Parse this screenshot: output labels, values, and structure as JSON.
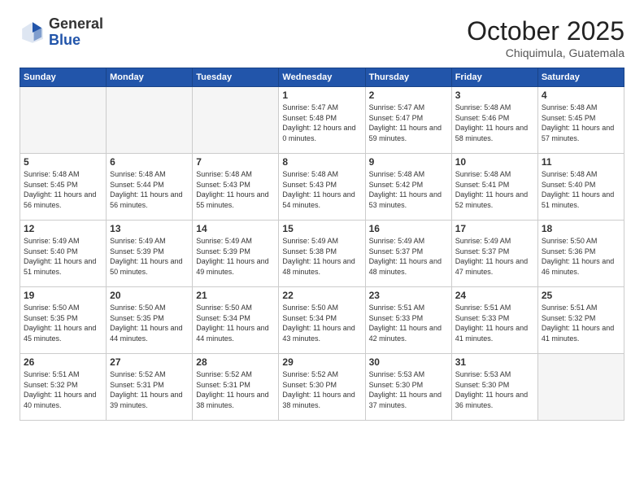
{
  "header": {
    "logo_general": "General",
    "logo_blue": "Blue",
    "month": "October 2025",
    "location": "Chiquimula, Guatemala"
  },
  "days_of_week": [
    "Sunday",
    "Monday",
    "Tuesday",
    "Wednesday",
    "Thursday",
    "Friday",
    "Saturday"
  ],
  "weeks": [
    [
      {
        "num": "",
        "empty": true
      },
      {
        "num": "",
        "empty": true
      },
      {
        "num": "",
        "empty": true
      },
      {
        "num": "1",
        "sunrise": "5:47 AM",
        "sunset": "5:48 PM",
        "daylight": "12 hours and 0 minutes."
      },
      {
        "num": "2",
        "sunrise": "5:47 AM",
        "sunset": "5:47 PM",
        "daylight": "11 hours and 59 minutes."
      },
      {
        "num": "3",
        "sunrise": "5:48 AM",
        "sunset": "5:46 PM",
        "daylight": "11 hours and 58 minutes."
      },
      {
        "num": "4",
        "sunrise": "5:48 AM",
        "sunset": "5:45 PM",
        "daylight": "11 hours and 57 minutes."
      }
    ],
    [
      {
        "num": "5",
        "sunrise": "5:48 AM",
        "sunset": "5:45 PM",
        "daylight": "11 hours and 56 minutes."
      },
      {
        "num": "6",
        "sunrise": "5:48 AM",
        "sunset": "5:44 PM",
        "daylight": "11 hours and 56 minutes."
      },
      {
        "num": "7",
        "sunrise": "5:48 AM",
        "sunset": "5:43 PM",
        "daylight": "11 hours and 55 minutes."
      },
      {
        "num": "8",
        "sunrise": "5:48 AM",
        "sunset": "5:43 PM",
        "daylight": "11 hours and 54 minutes."
      },
      {
        "num": "9",
        "sunrise": "5:48 AM",
        "sunset": "5:42 PM",
        "daylight": "11 hours and 53 minutes."
      },
      {
        "num": "10",
        "sunrise": "5:48 AM",
        "sunset": "5:41 PM",
        "daylight": "11 hours and 52 minutes."
      },
      {
        "num": "11",
        "sunrise": "5:48 AM",
        "sunset": "5:40 PM",
        "daylight": "11 hours and 51 minutes."
      }
    ],
    [
      {
        "num": "12",
        "sunrise": "5:49 AM",
        "sunset": "5:40 PM",
        "daylight": "11 hours and 51 minutes."
      },
      {
        "num": "13",
        "sunrise": "5:49 AM",
        "sunset": "5:39 PM",
        "daylight": "11 hours and 50 minutes."
      },
      {
        "num": "14",
        "sunrise": "5:49 AM",
        "sunset": "5:39 PM",
        "daylight": "11 hours and 49 minutes."
      },
      {
        "num": "15",
        "sunrise": "5:49 AM",
        "sunset": "5:38 PM",
        "daylight": "11 hours and 48 minutes."
      },
      {
        "num": "16",
        "sunrise": "5:49 AM",
        "sunset": "5:37 PM",
        "daylight": "11 hours and 48 minutes."
      },
      {
        "num": "17",
        "sunrise": "5:49 AM",
        "sunset": "5:37 PM",
        "daylight": "11 hours and 47 minutes."
      },
      {
        "num": "18",
        "sunrise": "5:50 AM",
        "sunset": "5:36 PM",
        "daylight": "11 hours and 46 minutes."
      }
    ],
    [
      {
        "num": "19",
        "sunrise": "5:50 AM",
        "sunset": "5:35 PM",
        "daylight": "11 hours and 45 minutes."
      },
      {
        "num": "20",
        "sunrise": "5:50 AM",
        "sunset": "5:35 PM",
        "daylight": "11 hours and 44 minutes."
      },
      {
        "num": "21",
        "sunrise": "5:50 AM",
        "sunset": "5:34 PM",
        "daylight": "11 hours and 44 minutes."
      },
      {
        "num": "22",
        "sunrise": "5:50 AM",
        "sunset": "5:34 PM",
        "daylight": "11 hours and 43 minutes."
      },
      {
        "num": "23",
        "sunrise": "5:51 AM",
        "sunset": "5:33 PM",
        "daylight": "11 hours and 42 minutes."
      },
      {
        "num": "24",
        "sunrise": "5:51 AM",
        "sunset": "5:33 PM",
        "daylight": "11 hours and 41 minutes."
      },
      {
        "num": "25",
        "sunrise": "5:51 AM",
        "sunset": "5:32 PM",
        "daylight": "11 hours and 41 minutes."
      }
    ],
    [
      {
        "num": "26",
        "sunrise": "5:51 AM",
        "sunset": "5:32 PM",
        "daylight": "11 hours and 40 minutes."
      },
      {
        "num": "27",
        "sunrise": "5:52 AM",
        "sunset": "5:31 PM",
        "daylight": "11 hours and 39 minutes."
      },
      {
        "num": "28",
        "sunrise": "5:52 AM",
        "sunset": "5:31 PM",
        "daylight": "11 hours and 38 minutes."
      },
      {
        "num": "29",
        "sunrise": "5:52 AM",
        "sunset": "5:30 PM",
        "daylight": "11 hours and 38 minutes."
      },
      {
        "num": "30",
        "sunrise": "5:53 AM",
        "sunset": "5:30 PM",
        "daylight": "11 hours and 37 minutes."
      },
      {
        "num": "31",
        "sunrise": "5:53 AM",
        "sunset": "5:30 PM",
        "daylight": "11 hours and 36 minutes."
      },
      {
        "num": "",
        "empty": true
      }
    ]
  ]
}
